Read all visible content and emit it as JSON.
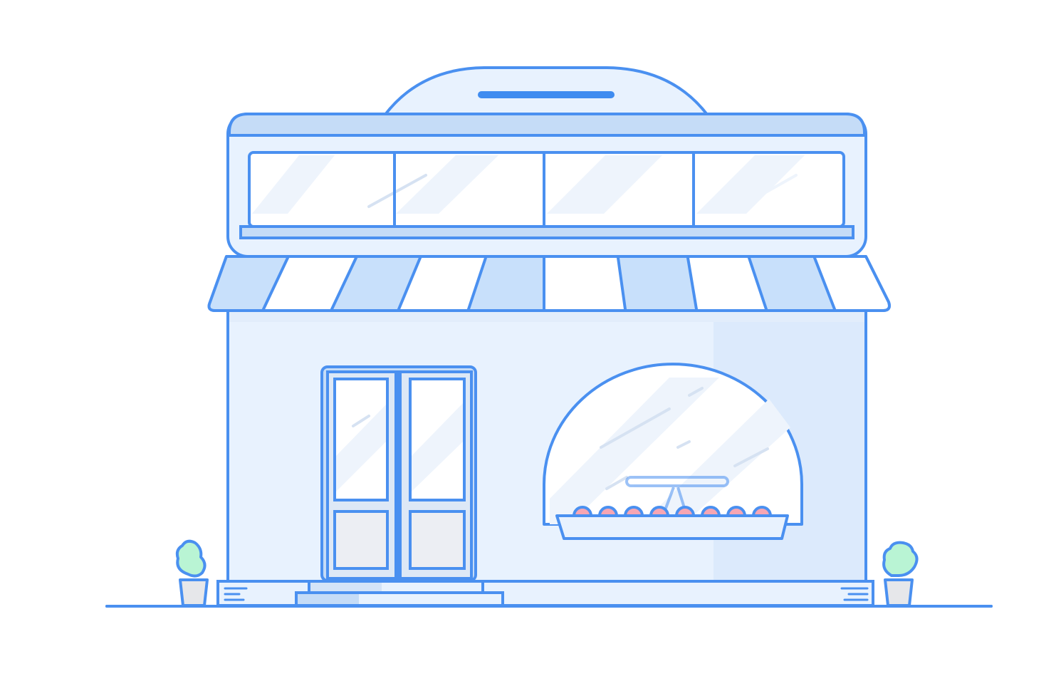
{
  "illustration": {
    "subject": "storefront-icon",
    "colors": {
      "outline": "#4a90f0",
      "fill_light": "#e8f2fe",
      "fill_mid": "#c5dcf7",
      "fill_awning": "#c8e0fb",
      "glass": "#ffffff",
      "glass_sheen": "#e9f1fb",
      "door_panel": "#eceef3",
      "plant": "#b9f4d4",
      "pot": "#e6e7ea",
      "cakes": "#f6a6b3",
      "background": "#ffffff"
    }
  }
}
